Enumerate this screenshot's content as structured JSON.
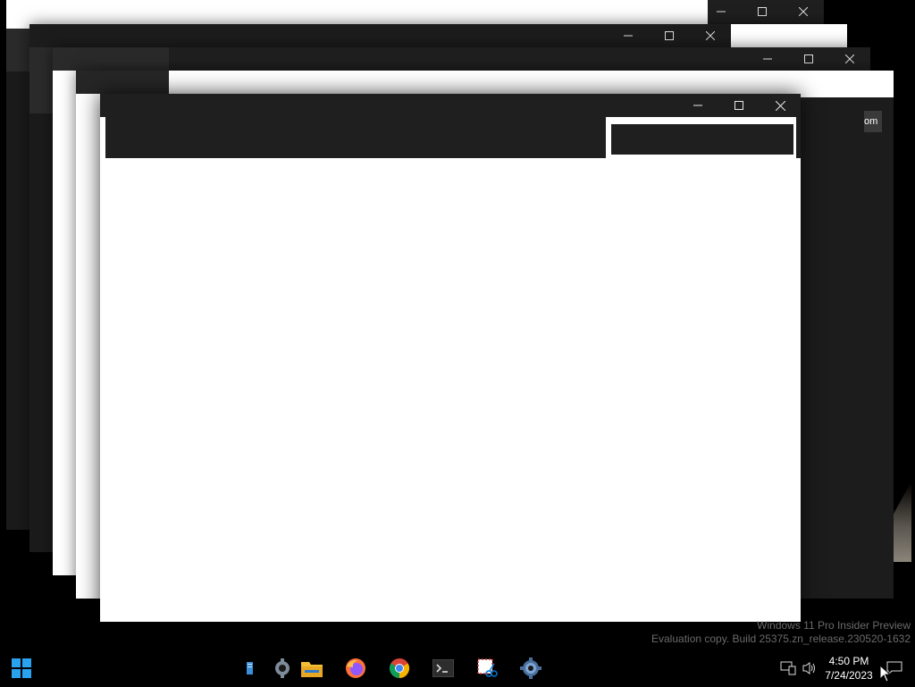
{
  "windows": {
    "back_4_peek_text": "om"
  },
  "caption_glyphs": {
    "minimize": "—",
    "maximize": "□",
    "close": "✕"
  },
  "watermark": {
    "line1": "Windows 11 Pro Insider Preview",
    "line2": "Evaluation copy. Build 25375.zn_release.230520-1632"
  },
  "taskbar": {
    "start_icon": "windows-start-icon",
    "apps": [
      {
        "name": "text-editor-icon"
      },
      {
        "name": "settings-gear-icon"
      },
      {
        "name": "file-explorer-icon"
      },
      {
        "name": "firefox-icon"
      },
      {
        "name": "chrome-icon"
      },
      {
        "name": "terminal-icon"
      },
      {
        "name": "snipping-tool-icon"
      },
      {
        "name": "settings-app-icon"
      }
    ],
    "tray": {
      "network_icon": "network-icon",
      "volume_icon": "volume-icon",
      "time": "4:50 PM",
      "date": "7/24/2023",
      "notifications_icon": "notification-icon"
    }
  },
  "colors": {
    "titlebar": "#1f1f1f",
    "window_body_dark": "#1b1b1b",
    "window_body_light": "#ffffff",
    "chrome_red": "#db4437",
    "chrome_yellow": "#f4b400",
    "chrome_green": "#0f9d58",
    "chrome_blue": "#4285f4",
    "explorer_yellow": "#f2c037",
    "firefox_orange": "#ff7139",
    "settings_blue": "#0078d4"
  }
}
